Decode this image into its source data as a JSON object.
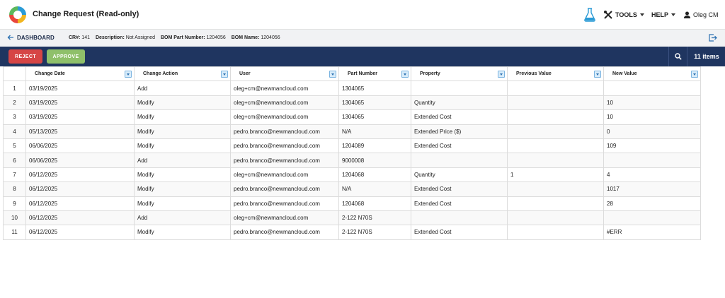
{
  "header": {
    "title": "Change Request (Read-only)",
    "tools_label": "TOOLS",
    "help_label": "HELP",
    "user_name": "Oleg CM"
  },
  "infobar": {
    "back_label": "DASHBOARD",
    "cr_label": "CR#:",
    "cr_value": "141",
    "description_label": "Description:",
    "description_value": "Not Assigned",
    "bom_part_label": "BOM Part Number:",
    "bom_part_value": "1204056",
    "bom_name_label": "BOM Name:",
    "bom_name_value": "1204056"
  },
  "actions": {
    "reject_label": "REJECT",
    "approve_label": "APPROVE",
    "items_count": "11 items"
  },
  "colors": {
    "navbar": "#1f3560",
    "reject": "#d64545",
    "approve": "#8fc06a"
  },
  "table": {
    "columns": [
      "Change Date",
      "Change Action",
      "User",
      "Part Number",
      "Property",
      "Previous Value",
      "New Value"
    ],
    "rows": [
      [
        "1",
        "03/19/2025",
        "Add",
        "oleg+cm@newmancloud.com",
        "1304065",
        "",
        "",
        ""
      ],
      [
        "2",
        "03/19/2025",
        "Modify",
        "oleg+cm@newmancloud.com",
        "1304065",
        "Quantity",
        "",
        "10"
      ],
      [
        "3",
        "03/19/2025",
        "Modify",
        "oleg+cm@newmancloud.com",
        "1304065",
        "Extended Cost",
        "",
        "10"
      ],
      [
        "4",
        "05/13/2025",
        "Modify",
        "pedro.branco@newmancloud.com",
        "N/A",
        "Extended Price ($)",
        "",
        "0"
      ],
      [
        "5",
        "06/06/2025",
        "Modify",
        "pedro.branco@newmancloud.com",
        "1204089",
        "Extended Cost",
        "",
        "109"
      ],
      [
        "6",
        "06/06/2025",
        "Add",
        "pedro.branco@newmancloud.com",
        "9000008",
        "",
        "",
        ""
      ],
      [
        "7",
        "06/12/2025",
        "Modify",
        "oleg+cm@newmancloud.com",
        "1204068",
        "Quantity",
        "1",
        "4"
      ],
      [
        "8",
        "06/12/2025",
        "Modify",
        "pedro.branco@newmancloud.com",
        "N/A",
        "Extended Cost",
        "",
        "1017"
      ],
      [
        "9",
        "06/12/2025",
        "Modify",
        "pedro.branco@newmancloud.com",
        "1204068",
        "Extended Cost",
        "",
        "28"
      ],
      [
        "10",
        "06/12/2025",
        "Add",
        "oleg+cm@newmancloud.com",
        "2-122 N70S",
        "",
        "",
        ""
      ],
      [
        "11",
        "06/12/2025",
        "Modify",
        "pedro.branco@newmancloud.com",
        "2-122 N70S",
        "Extended Cost",
        "",
        "#ERR"
      ]
    ]
  }
}
